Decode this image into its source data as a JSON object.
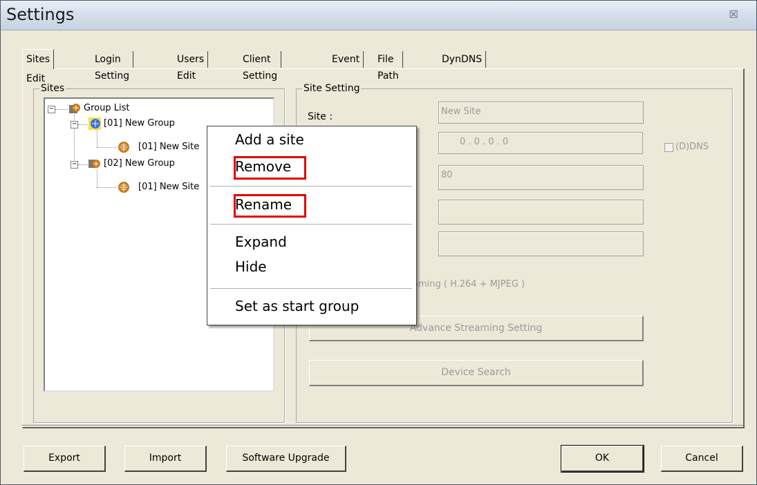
{
  "window": {
    "title": "Settings",
    "close_glyph": "☒"
  },
  "tabs": [
    {
      "label": "Sites Edit",
      "active": true
    },
    {
      "label": "Login Setting"
    },
    {
      "label": "Users Edit"
    },
    {
      "label": "Client Setting"
    },
    {
      "label": "Event"
    },
    {
      "label": "File Path"
    },
    {
      "label": "DynDNS"
    }
  ],
  "sites_panel": {
    "legend": "Sites",
    "tree": {
      "root": {
        "label": "Group List",
        "expander": "−"
      },
      "groups": [
        {
          "label": "[01] New Group",
          "expander": "−",
          "sites": [
            {
              "label": "[01] New Site"
            }
          ]
        },
        {
          "label": "[02] New Group",
          "expander": "−",
          "sites": [
            {
              "label": "[01] New Site"
            }
          ]
        }
      ]
    }
  },
  "site_setting": {
    "legend": "Site Setting",
    "site_label": "Site :",
    "site_value": "New Site",
    "ip_value": "0   .   0   .   0   .   0",
    "ddns_label": "(D)DNS",
    "port_value": "80",
    "streaming_text": "aming ( H.264 + MJPEG )",
    "advance_button": "Advance Streaming Setting",
    "device_search_button": "Device Search"
  },
  "context_menu": {
    "items": [
      "Add a site",
      "Remove",
      "Rename",
      "Expand",
      "Hide",
      "Set as start group"
    ],
    "highlighted": [
      "Remove",
      "Rename"
    ]
  },
  "footer": {
    "export": "Export",
    "import": "Import",
    "upgrade": "Software Upgrade",
    "ok": "OK",
    "cancel": "Cancel"
  },
  "colors": {
    "highlight": "#e00000",
    "window_bg": "#ece9d8"
  }
}
